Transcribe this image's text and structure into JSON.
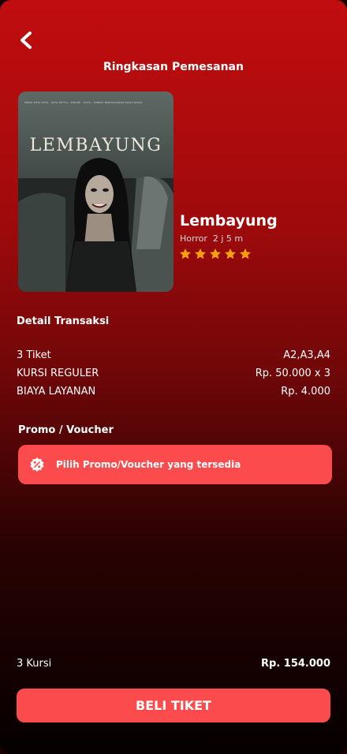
{
  "header": {
    "title": "Ringkasan Pemesanan",
    "back_icon": "chevron-left-icon"
  },
  "movie": {
    "poster": {
      "title": "LEMBAYUNG",
      "credits": "PRIMA MATA KUTU  ·  ARYA SEYTIA  ·  ZIDANE  ·  AISYA  ·  SUNRAY   BERDASARKAN KISAH NYATA"
    },
    "title": "Lembayung",
    "genre": "Horror",
    "duration": "2 j 5 m",
    "rating_stars": 5,
    "star_color": "#f5a013"
  },
  "transaction": {
    "section_title": "Detail Transaksi",
    "rows": [
      {
        "label": "3 Tiket",
        "value": "A2,A3,A4"
      },
      {
        "label": "KURSI REGULER",
        "value": "Rp. 50.000 x 3"
      },
      {
        "label": "BIAYA LAYANAN",
        "value": "Rp. 4.000"
      }
    ]
  },
  "promo": {
    "section_title": "Promo / Voucher",
    "button_label": "Pilih Promo/Voucher yang tersedia",
    "icon": "discount-icon"
  },
  "summary": {
    "seats": "3 Kursi",
    "total": "Rp. 154.000"
  },
  "buy_button": {
    "label": "BELI TIKET"
  },
  "colors": {
    "accent": "#fb4b4d",
    "background_top": "#c10d0f",
    "background_bottom": "#050000"
  }
}
